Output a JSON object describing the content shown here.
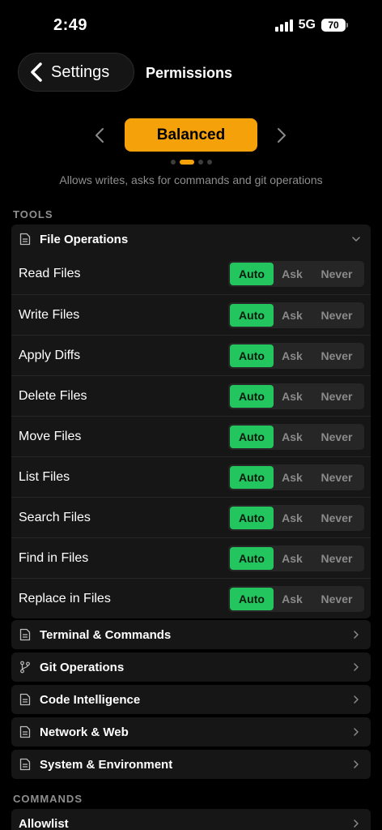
{
  "status_bar": {
    "time": "2:49",
    "network": "5G",
    "battery": "70"
  },
  "nav": {
    "back_label": "Settings",
    "title": "Permissions"
  },
  "preset": {
    "name": "Balanced",
    "description": "Allows writes, asks for commands and git operations",
    "page_index": 1,
    "page_count": 4,
    "accent": "#f5a20a"
  },
  "tools": {
    "header": "TOOLS",
    "expanded": {
      "title": "File Operations",
      "icon": "document-icon",
      "options": [
        "Auto",
        "Ask",
        "Never"
      ],
      "rows": [
        {
          "label": "Read Files",
          "value": "Auto"
        },
        {
          "label": "Write Files",
          "value": "Auto"
        },
        {
          "label": "Apply Diffs",
          "value": "Auto"
        },
        {
          "label": "Delete Files",
          "value": "Auto"
        },
        {
          "label": "Move Files",
          "value": "Auto"
        },
        {
          "label": "List Files",
          "value": "Auto"
        },
        {
          "label": "Search Files",
          "value": "Auto"
        },
        {
          "label": "Find in Files",
          "value": "Auto"
        },
        {
          "label": "Replace in Files",
          "value": "Auto"
        }
      ]
    },
    "collapsed": [
      {
        "title": "Terminal & Commands",
        "icon": "document-icon"
      },
      {
        "title": "Git Operations",
        "icon": "git-branch-icon"
      },
      {
        "title": "Code Intelligence",
        "icon": "document-icon"
      },
      {
        "title": "Network & Web",
        "icon": "document-icon"
      },
      {
        "title": "System & Environment",
        "icon": "document-icon"
      }
    ]
  },
  "commands": {
    "header": "COMMANDS",
    "items": [
      {
        "title": "Allowlist"
      }
    ]
  },
  "colors": {
    "selected": "#22c55e",
    "background": "#000000",
    "card": "#161616",
    "muted": "#8e8e8e"
  }
}
